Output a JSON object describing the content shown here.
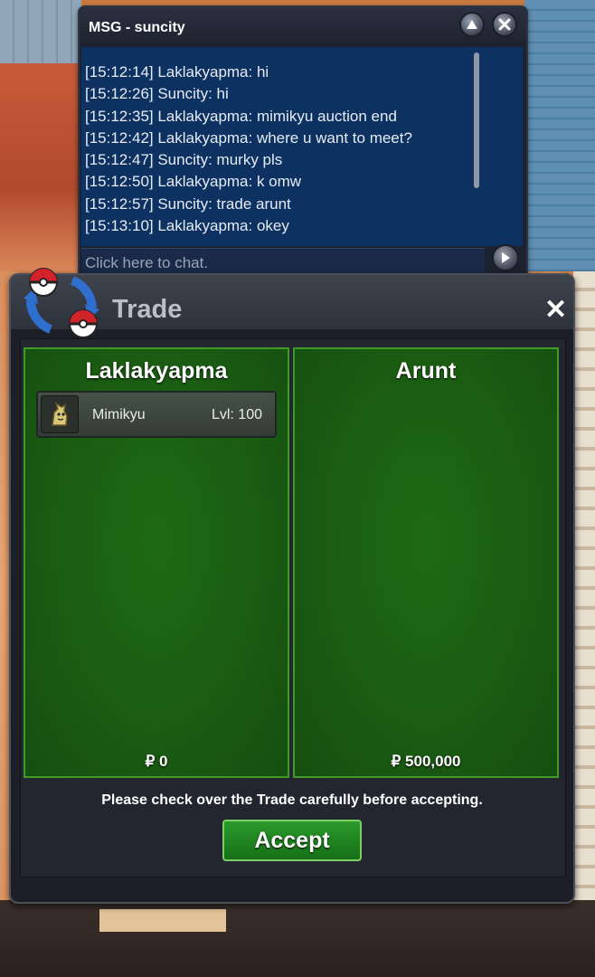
{
  "chat": {
    "title": "MSG - suncity",
    "up_icon": "chevron-up-icon",
    "close_icon": "close-icon",
    "send_icon": "play-arrow-icon",
    "messages": [
      "[15:12:14] Laklakyapma: hi",
      "[15:12:26] Suncity: hi",
      "[15:12:35] Laklakyapma: mimikyu auction end",
      "[15:12:42] Laklakyapma: where u want to meet?",
      "[15:12:47] Suncity: murky pls",
      "[15:12:50] Laklakyapma: k omw",
      "[15:12:57] Suncity: trade arunt",
      "[15:13:10] Laklakyapma: okey"
    ],
    "input_placeholder": "Click here to chat."
  },
  "trade": {
    "icon": "trade-pokeballs-icon",
    "title": "Trade",
    "close_label": "✕",
    "left": {
      "player": "Laklakyapma",
      "money": "₽ 0",
      "items": [
        {
          "icon": "mimikyu-sprite-icon",
          "name": "Mimikyu",
          "level": "Lvl: 100"
        }
      ]
    },
    "right": {
      "player": "Arunt",
      "money": "₽ 500,000",
      "items": []
    },
    "notice": "Please check over the Trade carefully before accepting.",
    "accept_label": "Accept"
  },
  "colors": {
    "panel_green": "#1a5c12",
    "panel_border": "#3f9a2a",
    "chat_blue": "#0d3262",
    "accept_green": "#1f861f"
  }
}
